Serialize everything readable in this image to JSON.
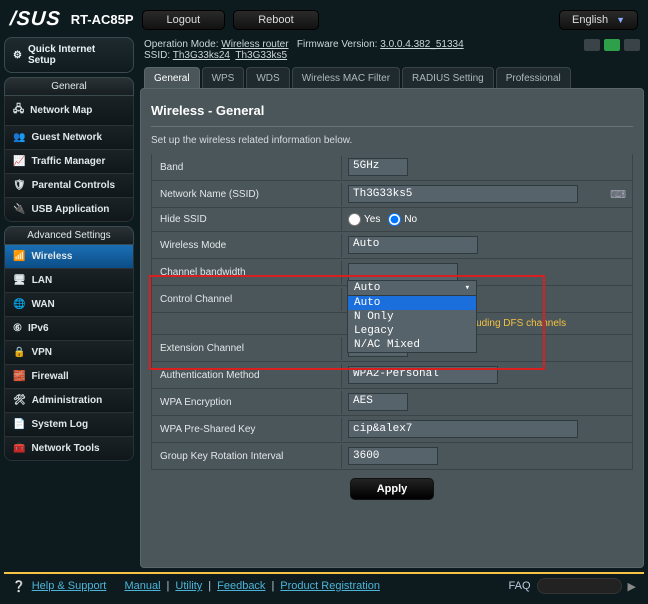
{
  "top": {
    "brand": "/SUS",
    "model": "RT-AC85P",
    "logout": "Logout",
    "reboot": "Reboot",
    "language": "English"
  },
  "meta": {
    "opmode_label": "Operation Mode:",
    "opmode_value": "Wireless router",
    "fw_label": "Firmware Version:",
    "fw_value": "3.0.0.4.382_51334",
    "ssid_label": "SSID:",
    "ssid1": "Th3G33ks24",
    "ssid2": "Th3G33ks5"
  },
  "quick": {
    "label": "Quick Internet Setup"
  },
  "nav": {
    "general_head": "General",
    "items_general": [
      "Network Map",
      "Guest Network",
      "Traffic Manager",
      "Parental Controls",
      "USB Application"
    ],
    "adv_head": "Advanced Settings",
    "items_adv": [
      "Wireless",
      "LAN",
      "WAN",
      "IPv6",
      "VPN",
      "Firewall",
      "Administration",
      "System Log",
      "Network Tools"
    ]
  },
  "tabs": [
    "General",
    "WPS",
    "WDS",
    "Wireless MAC Filter",
    "RADIUS Setting",
    "Professional"
  ],
  "panel": {
    "title": "Wireless - General",
    "subtitle": "Set up the wireless related information below.",
    "band_label": "Band",
    "band_value": "5GHz",
    "ssid_label": "Network Name (SSID)",
    "ssid_value": "Th3G33ks5",
    "hide_label": "Hide SSID",
    "hide_yes": "Yes",
    "hide_no": "No",
    "mode_label": "Wireless Mode",
    "mode_value": "Auto",
    "mode_options": [
      "Auto",
      "N Only",
      "Legacy",
      "N/AC Mixed"
    ],
    "bw_label": "Channel bandwidth",
    "ctrl_label": "Control Channel",
    "dfs_label": "Auto select channel including DFS channels",
    "ext_label": "Extension Channel",
    "ext_value": "Auto",
    "auth_label": "Authentication Method",
    "auth_value": "WPA2-Personal",
    "enc_label": "WPA Encryption",
    "enc_value": "AES",
    "psk_label": "WPA Pre-Shared Key",
    "psk_value": "cip&alex7",
    "gkr_label": "Group Key Rotation Interval",
    "gkr_value": "3600",
    "apply": "Apply"
  },
  "footer": {
    "help": "Help & Support",
    "manual": "Manual",
    "utility": "Utility",
    "feedback": "Feedback",
    "product": "Product Registration",
    "faq": "FAQ"
  }
}
